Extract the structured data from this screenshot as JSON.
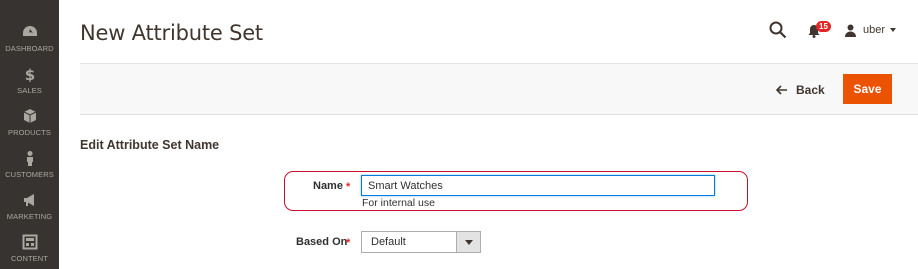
{
  "sidebar": {
    "items": [
      {
        "label": "DASHBOARD",
        "icon": "dashboard-icon"
      },
      {
        "label": "SALES",
        "icon": "dollar-icon"
      },
      {
        "label": "PRODUCTS",
        "icon": "cube-icon"
      },
      {
        "label": "CUSTOMERS",
        "icon": "person-icon"
      },
      {
        "label": "MARKETING",
        "icon": "megaphone-icon"
      },
      {
        "label": "CONTENT",
        "icon": "layout-icon"
      }
    ]
  },
  "header": {
    "title": "New Attribute Set",
    "notifications_count": "15",
    "username": "uber"
  },
  "actions": {
    "back_label": "Back",
    "save_label": "Save"
  },
  "form": {
    "section_title": "Edit Attribute Set Name",
    "name": {
      "label": "Name",
      "required_mark": "*",
      "value": "Smart Watches",
      "note": "For internal use"
    },
    "based_on": {
      "label": "Based On",
      "required_mark": "*",
      "selected": "Default"
    }
  },
  "colors": {
    "sidebar_bg": "#373330",
    "accent": "#eb5202",
    "highlight": "#c8102e",
    "focus": "#007bdb"
  }
}
